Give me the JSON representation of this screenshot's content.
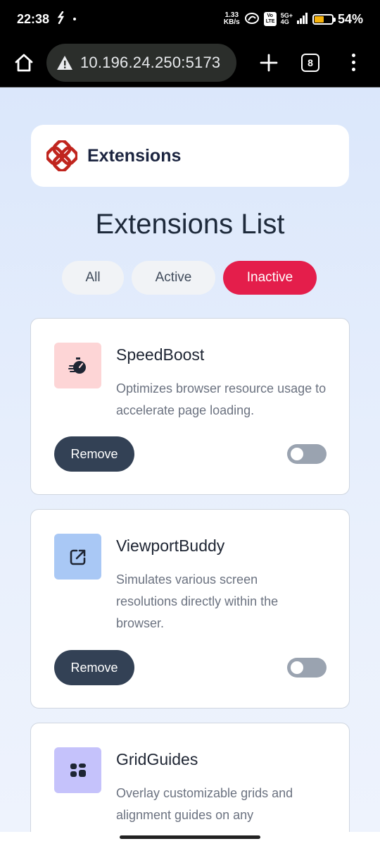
{
  "status_bar": {
    "time": "22:38",
    "net_speed_value": "1.33",
    "net_speed_unit": "KB/s",
    "battery_percent": "54%",
    "network": "5G+",
    "volte": "Vo LTE",
    "network_sub": "4G"
  },
  "browser": {
    "url": "10.196.24.250:5173",
    "tab_count": "8"
  },
  "header": {
    "logo_text": "Extensions"
  },
  "page": {
    "title": "Extensions List"
  },
  "filters": {
    "all": "All",
    "active": "Active",
    "inactive": "Inactive",
    "selected": "Inactive"
  },
  "extensions": [
    {
      "name": "SpeedBoost",
      "description": "Optimizes browser resource usage to accelerate page loading.",
      "remove_label": "Remove",
      "enabled": false,
      "icon": "speed-icon",
      "icon_bg": "#fdd5d6"
    },
    {
      "name": "ViewportBuddy",
      "description": "Simulates various screen resolutions directly within the browser.",
      "remove_label": "Remove",
      "enabled": false,
      "icon": "external-link-icon",
      "icon_bg": "#a9c8f5"
    },
    {
      "name": "GridGuides",
      "description": "Overlay customizable grids and alignment guides on any",
      "icon": "grid-icon",
      "icon_bg": "#c5c2fb"
    }
  ],
  "colors": {
    "accent": "#e41e4b",
    "remove_button": "#334155",
    "toggle_off": "#9aa3b0",
    "logo": "#c0251e"
  }
}
